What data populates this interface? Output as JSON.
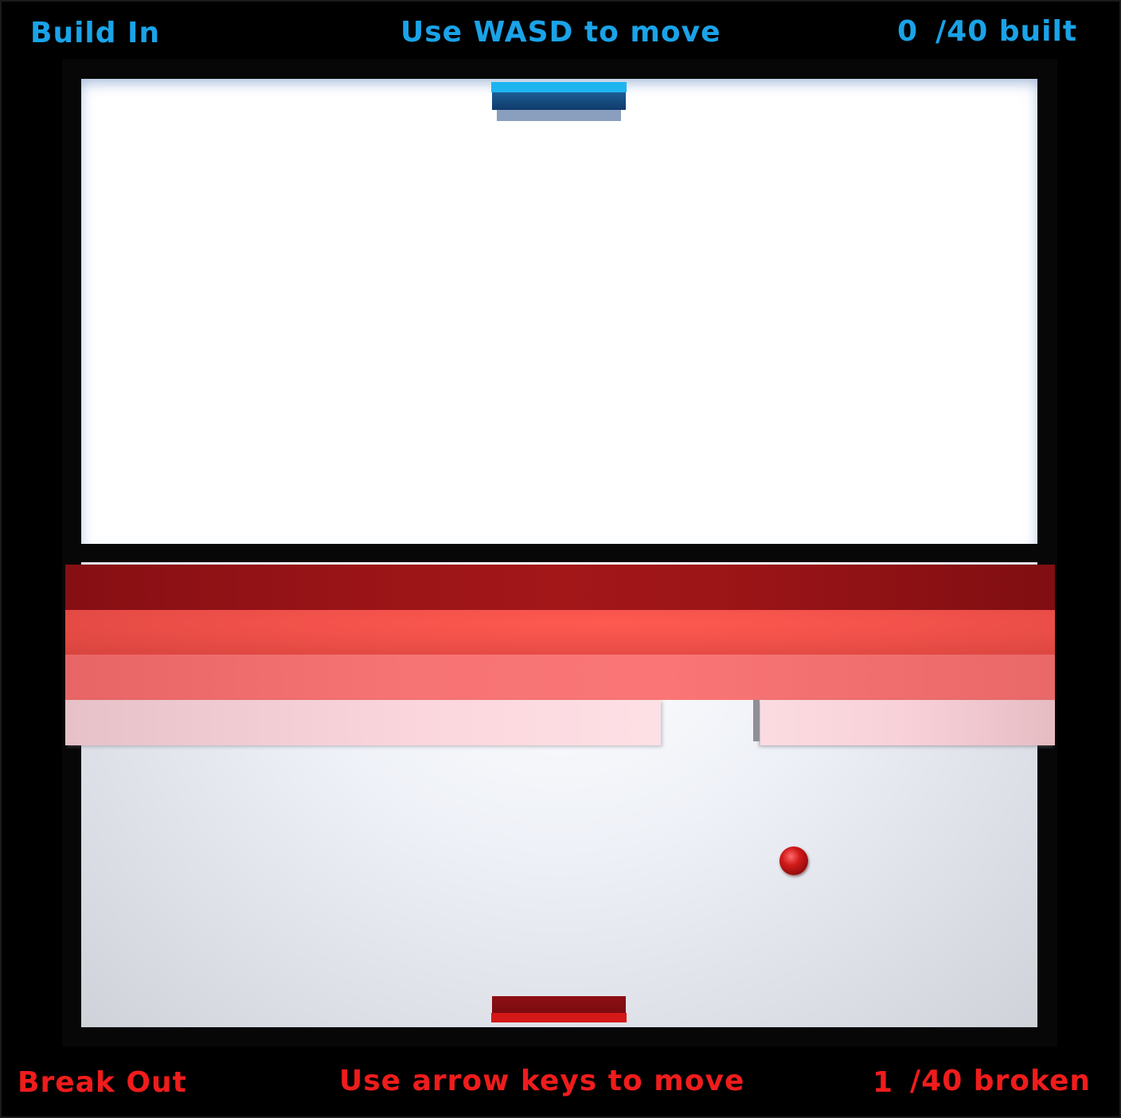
{
  "build_in": {
    "title": "Build In",
    "instructions": "Use WASD to move",
    "count": "0",
    "count_suffix": "/40 built"
  },
  "break_out": {
    "title": "Break Out",
    "instructions": "Use arrow keys to move",
    "count": "1",
    "count_suffix": "/40 broken"
  },
  "colors": {
    "build_in_text": "#1aa3e8",
    "break_out_text": "#ef1c1c",
    "blue_paddle": "#1d5d94",
    "red_paddle": "#8e0f14",
    "ball": "#d11a1a",
    "brick_row_1": "#9d1517",
    "brick_row_2": "#f0514a",
    "brick_row_3": "#f77474",
    "brick_row_4": "#fbd6dd"
  },
  "brick_rows": [
    {
      "row": 1,
      "complete": true
    },
    {
      "row": 2,
      "complete": true
    },
    {
      "row": 3,
      "complete": true
    },
    {
      "row": 4,
      "complete": false
    }
  ]
}
